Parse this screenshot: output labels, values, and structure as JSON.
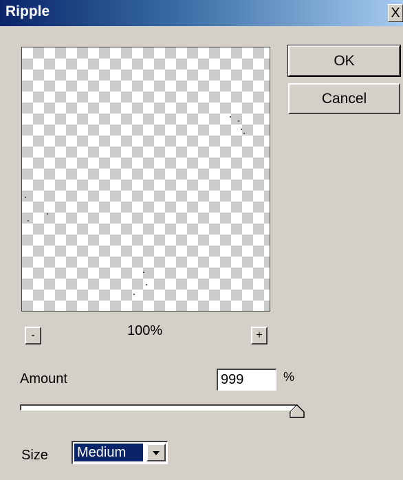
{
  "window": {
    "title": "Ripple",
    "close_glyph": "X"
  },
  "buttons": {
    "ok": "OK",
    "cancel": "Cancel"
  },
  "preview": {
    "zoom_minus": "-",
    "zoom_level": "100%",
    "zoom_plus": "+"
  },
  "amount": {
    "label": "Amount",
    "value": "999",
    "unit": "%",
    "slider_fraction": 1.0
  },
  "size": {
    "label": "Size",
    "value": "Medium",
    "arrow_icon": "chevron-down-icon"
  },
  "colors": {
    "title_start": "#0a246a",
    "title_end": "#a6caf0",
    "face": "#d4d0c8",
    "selection": "#0a246a"
  }
}
